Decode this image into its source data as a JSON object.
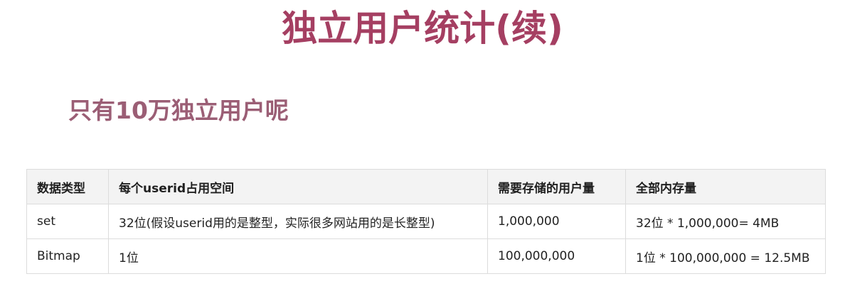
{
  "title": "独立用户统计(续)",
  "subtitle": "只有10万独立用户呢",
  "table": {
    "headers": [
      "数据类型",
      "每个userid占用空间",
      "需要存储的用户量",
      "全部内存量"
    ],
    "rows": [
      [
        "set",
        "32位(假设userid用的是整型，实际很多网站用的是长整型)",
        "1,000,000",
        "32位 * 1,000,000= 4MB"
      ],
      [
        "Bitmap",
        "1位",
        "100,000,000",
        "1位 * 100,000,000 = 12.5MB"
      ]
    ]
  },
  "colors": {
    "title": "#a53f62",
    "subtitle": "#9b5e75",
    "header_bg": "#f3f3f3",
    "border": "#dcdcdc"
  }
}
